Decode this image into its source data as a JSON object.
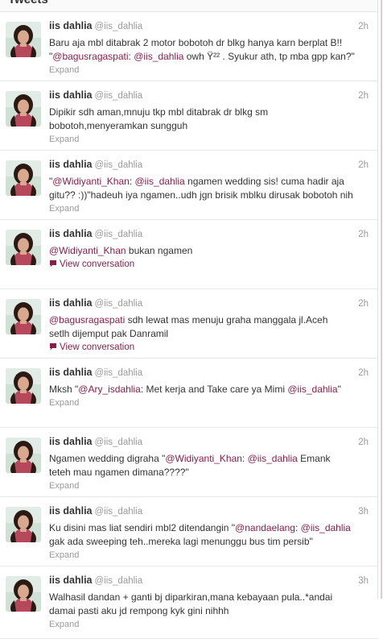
{
  "header": {
    "title": "Tweets"
  },
  "tweets": [
    {
      "name": "iis dahlia",
      "handle": "@iis_dahlia",
      "time": "2h",
      "lines": [
        [
          {
            "t": "Baru aja mbl ditabrak 2 motor bobotoh dr blkg hanya karn berplat B!!"
          }
        ],
        [
          {
            "t": "\""
          },
          {
            "t": "@bagusragaspati",
            "m": true
          },
          {
            "t": ": "
          },
          {
            "t": "@iis_dahlia",
            "m": true
          },
          {
            "t": " owh Ÿ²² . Syukur ath, tp mba gpp kan?\""
          }
        ]
      ],
      "action": "Expand",
      "action_type": "expand"
    },
    {
      "name": "iis dahlia",
      "handle": "@iis_dahlia",
      "time": "2h",
      "lines": [
        [
          {
            "t": "Dipikir sdh aman,mnuju tkp mbl ditabrak dr blkg sm"
          }
        ],
        [
          {
            "t": "bobotoh,menyeramkan sungguh"
          }
        ]
      ],
      "action": "Expand",
      "action_type": "expand"
    },
    {
      "name": "iis dahlia",
      "handle": "@iis_dahlia",
      "time": "2h",
      "lines": [
        [
          {
            "t": "\""
          },
          {
            "t": "@Widiyanti_Khan",
            "m": true
          },
          {
            "t": ": "
          },
          {
            "t": "@iis_dahlia",
            "m": true
          },
          {
            "t": "  ngamen wedding sis! cuma hadir aja"
          }
        ],
        [
          {
            "t": "gitu?? :))\"hadeuh iya ngamen..udh jgn brisik mblku dirusak bobotoh nih"
          }
        ]
      ],
      "action": "Expand",
      "action_type": "expand"
    },
    {
      "name": "iis dahlia",
      "handle": "@iis_dahlia",
      "time": "2h",
      "lines": [
        [
          {
            "t": "@Widiyanti_Khan",
            "m": true
          },
          {
            "t": " bukan ngamen"
          }
        ]
      ],
      "action": "View conversation",
      "action_type": "conversation"
    },
    {
      "name": "iis dahlia",
      "handle": "@iis_dahlia",
      "time": "2h",
      "lines": [
        [
          {
            "t": "@bagusragaspati",
            "m": true
          },
          {
            "t": " sdh lewat mas menuju graha manggala jl.Aceh"
          }
        ],
        [
          {
            "t": "setlh dijemput pak Danramil"
          }
        ]
      ],
      "action": "View conversation",
      "action_type": "conversation"
    },
    {
      "name": "iis dahlia",
      "handle": "@iis_dahlia",
      "time": "2h",
      "lines": [
        [
          {
            "t": "Mksh  \""
          },
          {
            "t": "@Ary_isdahlia",
            "m": true
          },
          {
            "t": ": Met kerja and Take care ya Mimi "
          },
          {
            "t": "@iis_dahlia",
            "m": true
          },
          {
            "t": "\""
          }
        ]
      ],
      "action": "Expand",
      "action_type": "expand"
    },
    {
      "name": "iis dahlia",
      "handle": "@iis_dahlia",
      "time": "2h",
      "lines": [
        [
          {
            "t": "Ngamen  wedding digraha \""
          },
          {
            "t": "@Widiyanti_Khan",
            "m": true
          },
          {
            "t": ": "
          },
          {
            "t": "@iis_dahlia",
            "m": true
          },
          {
            "t": " Emank"
          }
        ],
        [
          {
            "t": "teteh mau ngamen dimana????\""
          }
        ]
      ],
      "action": "Expand",
      "action_type": "expand"
    },
    {
      "name": "iis dahlia",
      "handle": "@iis_dahlia",
      "time": "3h",
      "lines": [
        [
          {
            "t": "Ku disini mas liat sendiri mbl2 ditendangin \""
          },
          {
            "t": "@nandaelang",
            "m": true
          },
          {
            "t": ": "
          },
          {
            "t": "@iis_dahlia",
            "m": true
          }
        ],
        [
          {
            "t": "gak ada sweeping teh..mereka lagi menunggu bus tim persib\""
          }
        ]
      ],
      "action": "Expand",
      "action_type": "expand"
    },
    {
      "name": "iis dahlia",
      "handle": "@iis_dahlia",
      "time": "3h",
      "lines": [
        [
          {
            "t": "Walhasil dandan + ganti bj diparkiran,mana kebayaan pula..*andai"
          }
        ],
        [
          {
            "t": "damai pasti aku jd rempong kyk gini nihhh"
          }
        ]
      ],
      "action": "Expand",
      "action_type": "expand"
    }
  ]
}
